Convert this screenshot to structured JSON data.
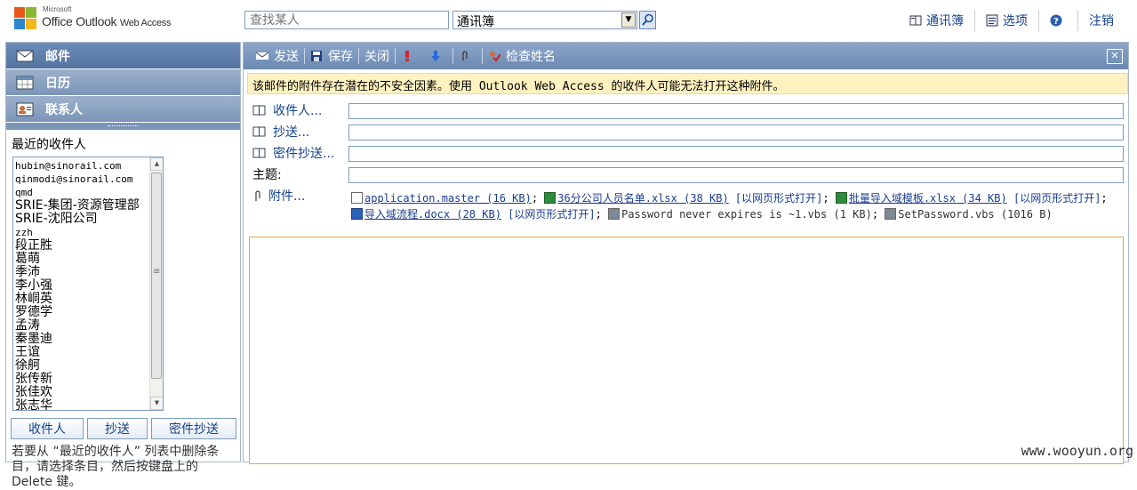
{
  "brand": {
    "small": "Microsoft",
    "name": "Office Outlook",
    "suffix": "Web Access"
  },
  "search": {
    "placeholder": "查找某人",
    "scope": "通讯簿"
  },
  "toplinks": [
    {
      "label": "通讯簿",
      "icon": "address-book-icon"
    },
    {
      "label": "选项",
      "icon": "options-icon"
    },
    {
      "label": "",
      "icon": "help-icon"
    },
    {
      "label": "注销",
      "icon": ""
    }
  ],
  "nav": {
    "items": [
      {
        "label": "邮件",
        "icon": "mail-icon",
        "active": true
      },
      {
        "label": "日历",
        "icon": "calendar-icon",
        "active": false
      },
      {
        "label": "联系人",
        "icon": "contacts-icon",
        "active": false
      }
    ],
    "recent_title": "最近的收件人",
    "recent": [
      "hubin@sinorail.com",
      "qinmodi@sinorail.com",
      "qmd",
      "SRIE-集团-资源管理部",
      "SRIE-沈阳公司",
      "zzh",
      "段正胜",
      "葛萌",
      "季沛",
      "李小强",
      "林峒英",
      "罗德学",
      "孟涛",
      "秦墨迪",
      "王谊",
      "徐舸",
      "张传新",
      "张佳欢",
      "张志华"
    ],
    "buttons": {
      "to": "收件人",
      "cc": "抄送",
      "bcc": "密件抄送"
    },
    "hint": "若要从 “最近的收件人” 列表中删除条目，请选择条目，然后按键盘上的 Delete 键。"
  },
  "toolbar": {
    "send": "发送",
    "save": "保存",
    "close": "关闭",
    "check_names": "检查姓名"
  },
  "warning": "该邮件的附件存在潜在的不安全因素。使用 Outlook Web Access 的收件人可能无法打开这种附件。",
  "fields": {
    "to": "收件人...",
    "cc": "抄送...",
    "bcc": "密件抄送...",
    "subject": "主题:",
    "attach": "附件..."
  },
  "attachments": [
    {
      "name": "application.master (16 KB)",
      "web": "",
      "linked": true,
      "icon": "file-icon"
    },
    {
      "name": "36分公司人员名单.xlsx (38 KB)",
      "web": "[以网页形式打开]",
      "linked": true,
      "icon": "excel-icon"
    },
    {
      "name": "批量导入域模板.xlsx (34 KB)",
      "web": "[以网页形式打开]",
      "linked": true,
      "icon": "excel-icon"
    },
    {
      "name": "导入域流程.docx (28 KB)",
      "web": "[以网页形式打开]",
      "linked": true,
      "icon": "word-icon"
    },
    {
      "name": "Password never expires is ~1.vbs (1 KB)",
      "web": "",
      "linked": false,
      "icon": "script-icon"
    },
    {
      "name": "SetPassword.vbs (1016 B)",
      "web": "",
      "linked": false,
      "icon": "script-icon"
    }
  ],
  "watermark": "www.wooyun.org",
  "colors": {
    "nav_active": "#54739f",
    "nav": "#7b95b7",
    "warning_bg": "#fff2c0",
    "link": "#15428b"
  }
}
